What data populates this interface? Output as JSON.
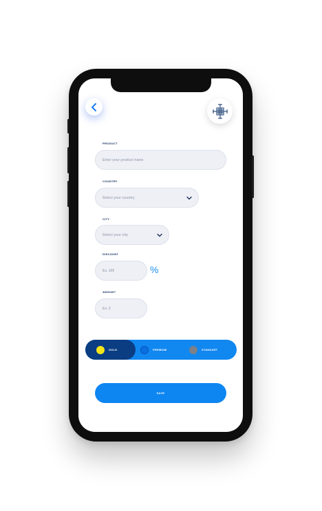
{
  "header": {
    "back_icon": "chevron-left-icon",
    "logo_icon": "cross-emblem-icon"
  },
  "form": {
    "product": {
      "label": "PRODUCT",
      "placeholder": "Enter your product name"
    },
    "country": {
      "label": "COUNTRY",
      "placeholder": "Select your country"
    },
    "city": {
      "label": "CITY",
      "placeholder": "Select your city"
    },
    "discount": {
      "label": "DISCOUNT",
      "placeholder": "Ex. 10€",
      "suffix": "%"
    },
    "amount": {
      "label": "AMOUNT",
      "placeholder": "Ex. 3"
    }
  },
  "plans": {
    "selected": "GOLD",
    "options": [
      {
        "label": "GOLD",
        "dot_color": "#f5e51b"
      },
      {
        "label": "PREMIUM",
        "dot_color": "#0a6fe0"
      },
      {
        "label": "STANDART",
        "dot_color": "#7c8088"
      }
    ]
  },
  "save_label": "SAVE",
  "colors": {
    "accent": "#0d86f2",
    "selected_plan": "#0b3d82",
    "label_text": "#0d2a5c",
    "field_bg": "#eef0f6"
  }
}
